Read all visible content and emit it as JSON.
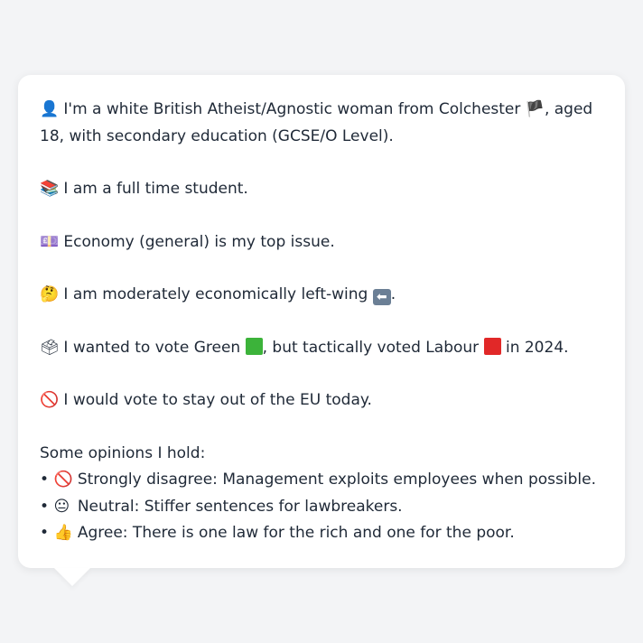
{
  "intro": {
    "icon": "person-silhouette-icon",
    "icon_glyph": "👤",
    "text_a": "I'm a white British Atheist/Agnostic woman from Colchester",
    "flag_icon": "england-flag-icon",
    "flag_glyph": "🏴",
    "text_b": ", aged 18, with secondary education (GCSE/O Level)."
  },
  "occupation": {
    "icon": "books-icon",
    "icon_glyph": "📚",
    "text": "I am a full time student."
  },
  "top_issue": {
    "icon": "money-icon",
    "icon_glyph": "💷",
    "text": "Economy (general) is my top issue."
  },
  "economic_view": {
    "icon": "thinking-face-icon",
    "icon_glyph": "🤔",
    "text": "I am moderately economically left-wing",
    "arrow_icon": "left-arrow-icon",
    "arrow_glyph": "⬅",
    "suffix": "."
  },
  "vote": {
    "icon": "ballot-box-icon",
    "icon_glyph": "🗳",
    "text_a": "I wanted to vote Green",
    "green_color": "#3cb33a",
    "text_b": ", but tactically voted Labour",
    "red_color": "#e12828",
    "text_c": "in 2024."
  },
  "eu": {
    "icon": "prohibited-icon",
    "icon_glyph": "🚫",
    "text": "I would vote to stay out of the EU today."
  },
  "opinions": {
    "heading": "Some opinions I hold:",
    "bullet": "•",
    "items": [
      {
        "icon": "prohibited-icon",
        "icon_glyph": "🚫",
        "text": "Strongly disagree: Management exploits employees when possible."
      },
      {
        "icon": "neutral-face-icon",
        "icon_glyph": "😐",
        "text": "Neutral: Stiffer sentences for lawbreakers."
      },
      {
        "icon": "thumbs-up-icon",
        "icon_glyph": "👍",
        "text": "Agree: There is one law for the rich and one for the poor."
      }
    ]
  }
}
